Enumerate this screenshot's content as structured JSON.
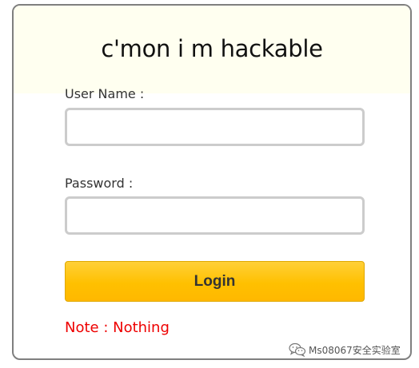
{
  "form": {
    "title": "c'mon i m hackable",
    "username_label": "User Name :",
    "username_value": "",
    "password_label": "Password :",
    "password_value": "",
    "login_label": "Login",
    "note": "Note : Nothing"
  },
  "watermark": {
    "icon": "wechat-icon",
    "text": "Ms08067安全实验室"
  },
  "colors": {
    "header_bg": "#fffff0",
    "button": "#ffc000",
    "note": "#ee0000",
    "border": "#7f7f7f"
  }
}
